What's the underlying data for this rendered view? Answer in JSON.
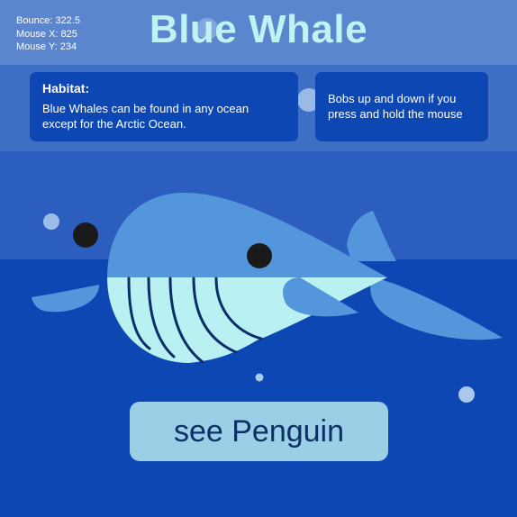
{
  "debug": {
    "bounce": "Bounce: 322.5",
    "mouse_x": "Mouse X: 825",
    "mouse_y": "Mouse Y: 234"
  },
  "title": "Blue Whale",
  "habitat": {
    "heading": "Habitat:",
    "text": "Blue Whales can be found in any ocean except for the Arctic Ocean."
  },
  "tip": "Bobs up and down if you press and hold the mouse",
  "button_label": "see Penguin",
  "colors": {
    "sky_top": "#5b85cd",
    "sky_mid": "#3f6fc4",
    "sky_low": "#2b5ebf",
    "ocean": "#0d47b3",
    "whale_body": "#5496dc",
    "whale_belly": "#b9f1f3",
    "belly_lines": "#0a2c68",
    "title": "#bff2f2",
    "button": "#9bcfe6",
    "bubble": "#a9c8ec"
  }
}
